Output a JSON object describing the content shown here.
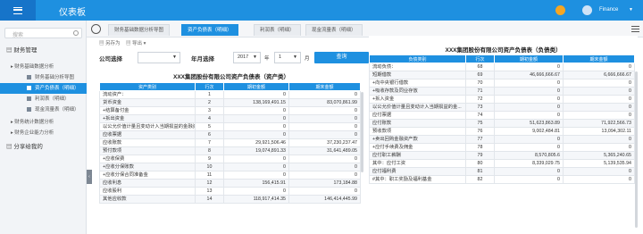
{
  "app": {
    "title": "仪表板",
    "user": "Finance"
  },
  "sidebar": {
    "search_placeholder": "搜索",
    "items": [
      {
        "label": "财务管理",
        "level": 1,
        "active": false
      },
      {
        "label": "财务基础数据分析",
        "level": 2,
        "active": false
      },
      {
        "label": "财务基础分析导图",
        "level": 3,
        "active": false
      },
      {
        "label": "资产负债表（明细）",
        "level": 3,
        "active": true
      },
      {
        "label": "利润表（明细）",
        "level": 3,
        "active": false
      },
      {
        "label": "现金流量表（明细）",
        "level": 3,
        "active": false
      },
      {
        "label": "财务统计数据分析",
        "level": 2,
        "active": false
      },
      {
        "label": "财务企业能力分析",
        "level": 2,
        "active": false
      },
      {
        "label": "分享给我的",
        "level": 1,
        "active": false
      }
    ]
  },
  "tabs": [
    {
      "label": "财务基础数据分析导图",
      "active": false
    },
    {
      "label": "资产负债表（明细）",
      "active": true
    },
    {
      "label": "利润表（明细）",
      "active": false
    },
    {
      "label": "现金流量表（明细）",
      "active": false
    }
  ],
  "toolbar": {
    "save": "另存为",
    "export": "导出"
  },
  "filters": {
    "company_label": "公司选择",
    "company_value": "",
    "period_label": "年月选择",
    "year_value": "2017",
    "year_unit": "年",
    "month_value": "1",
    "month_unit": "月",
    "query_label": "查询"
  },
  "left_table": {
    "title": "XXX集团股份有限公司资产负债表（资产类）",
    "headers": [
      "资产类别",
      "行次",
      "期初金额",
      "期末金额"
    ],
    "rows": [
      [
        "流动资产：",
        "1",
        "0",
        "0"
      ],
      [
        "货币资金",
        "2",
        "138,169,491.15",
        "83,070,861.99"
      ],
      [
        "+结算备付金",
        "3",
        "0",
        "0"
      ],
      [
        "+拆出资金",
        "4",
        "0",
        "0"
      ],
      [
        "以公允价值计量且变动计入当期损益的金融资...",
        "5",
        "0",
        "0"
      ],
      [
        "应收票据",
        "6",
        "0",
        "0"
      ],
      [
        "应收账款",
        "7",
        "29,921,506.46",
        "37,230,237.47"
      ],
      [
        "预付款项",
        "8",
        "19,074,891.33",
        "31,641,489.05"
      ],
      [
        "+应收保费",
        "9",
        "0",
        "0"
      ],
      [
        "+应收分保账款",
        "10",
        "0",
        "0"
      ],
      [
        "+应收分保合同准备金",
        "11",
        "0",
        "0"
      ],
      [
        "应收利息",
        "12",
        "156,415.91",
        "173,184.88"
      ],
      [
        "应收股利",
        "13",
        "0",
        "0"
      ],
      [
        "其他应收款",
        "14",
        "118,917,414.35",
        "146,414,445.99"
      ]
    ]
  },
  "right_table": {
    "title": "XXX集团股份有限公司资产负债表（负债类）",
    "headers": [
      "负债类别",
      "行次",
      "期初金额",
      "期末金额"
    ],
    "rows": [
      [
        "流动负债：",
        "68",
        "0",
        "0"
      ],
      [
        "短期借款",
        "69",
        "46,666,666.67",
        "6,666,666.67"
      ],
      [
        "+向中央银行借款",
        "70",
        "0",
        "0"
      ],
      [
        "+吸收存款及同业存放",
        "71",
        "0",
        "0"
      ],
      [
        "+拆入资金",
        "72",
        "0",
        "0"
      ],
      [
        "以公允价值计量且变动计入当期损益的金...",
        "73",
        "0",
        "0"
      ],
      [
        "应付票据",
        "74",
        "0",
        "0"
      ],
      [
        "应付账款",
        "75",
        "51,623,863.89",
        "71,922,566.73"
      ],
      [
        "预收款项",
        "76",
        "9,002,484.81",
        "13,094,302.11"
      ],
      [
        "+卖出回购金融资产款",
        "77",
        "0",
        "0"
      ],
      [
        "+应付手续费及佣金",
        "78",
        "0",
        "0"
      ],
      [
        "应付职工薪酬",
        "79",
        "8,570,805.6",
        "5,365,240.65"
      ],
      [
        "其中：应付工资",
        "80",
        "8,339,029.75",
        "5,139,535.94"
      ],
      [
        "应付福利费",
        "81",
        "0",
        "0"
      ],
      [
        "#其中：职工奖励及福利基金",
        "82",
        "0",
        "0"
      ]
    ]
  }
}
